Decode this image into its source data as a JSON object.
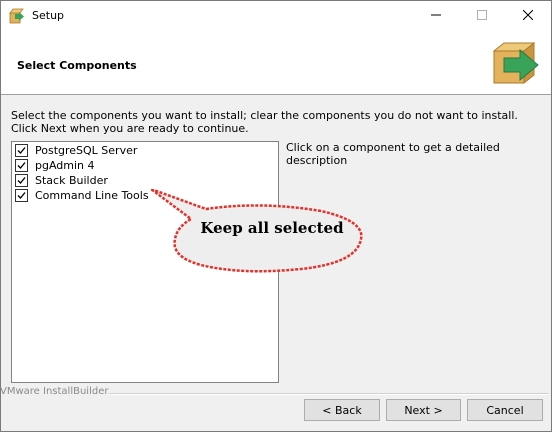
{
  "window": {
    "title": "Setup"
  },
  "header": {
    "title": "Select Components"
  },
  "instructions": "Select the components you want to install; clear the components you do not want to install. Click Next when you are ready to continue.",
  "components": [
    {
      "label": "PostgreSQL Server",
      "checked": true
    },
    {
      "label": "pgAdmin 4",
      "checked": true
    },
    {
      "label": "Stack Builder",
      "checked": true
    },
    {
      "label": "Command Line Tools",
      "checked": true
    }
  ],
  "description": "Click on a component to get a detailed description",
  "annotation": "Keep all selected",
  "brand": "VMware InstallBuilder",
  "buttons": {
    "back": "< Back",
    "next": "Next >",
    "cancel": "Cancel"
  },
  "colors": {
    "logo_green": "#3aa35a",
    "logo_tan": "#e3b25b",
    "annotation_border": "#e3322b"
  }
}
